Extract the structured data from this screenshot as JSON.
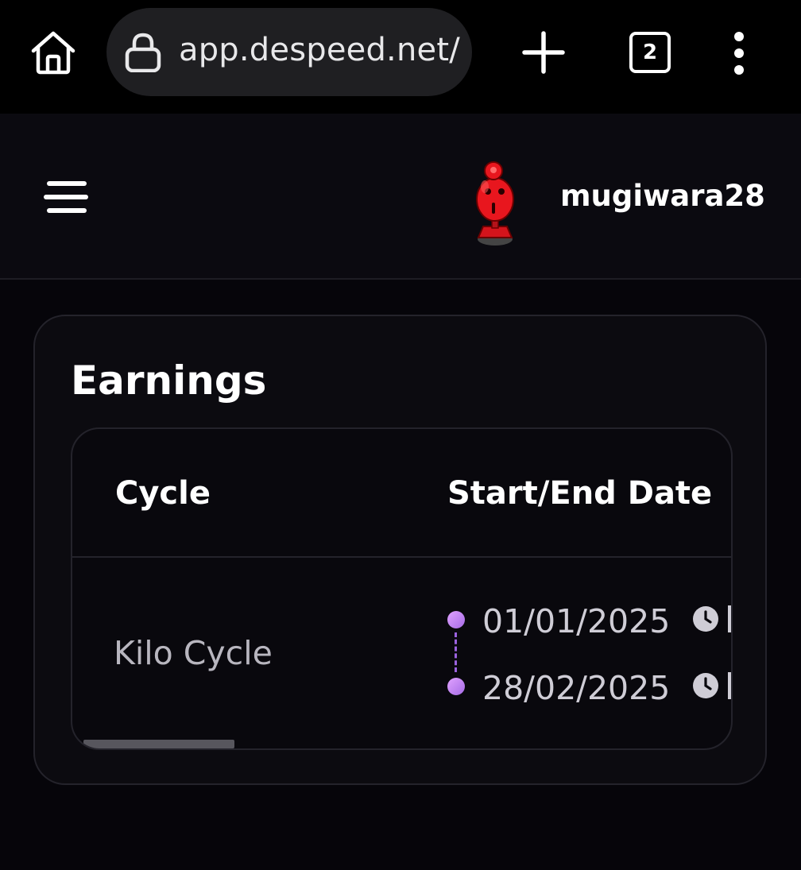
{
  "browser": {
    "url": "app.despeed.net/",
    "tab_count": "2",
    "icons": {
      "home": "home-icon",
      "lock": "lock-icon",
      "new_tab": "plus-icon",
      "menu": "more-vertical-icon"
    }
  },
  "header": {
    "username": "mugiwara28",
    "avatar": "red-robot-avatar",
    "menu_icon": "hamburger-menu-icon"
  },
  "earnings": {
    "title": "Earnings",
    "columns": [
      "Cycle",
      "Start/End Date"
    ],
    "rows": [
      {
        "cycle": "Kilo Cycle",
        "start_date": "01/01/2025",
        "end_date": "28/02/2025"
      }
    ]
  },
  "colors": {
    "accent": "#a66be6",
    "background": "#06050a",
    "card": "#0c0b10"
  }
}
